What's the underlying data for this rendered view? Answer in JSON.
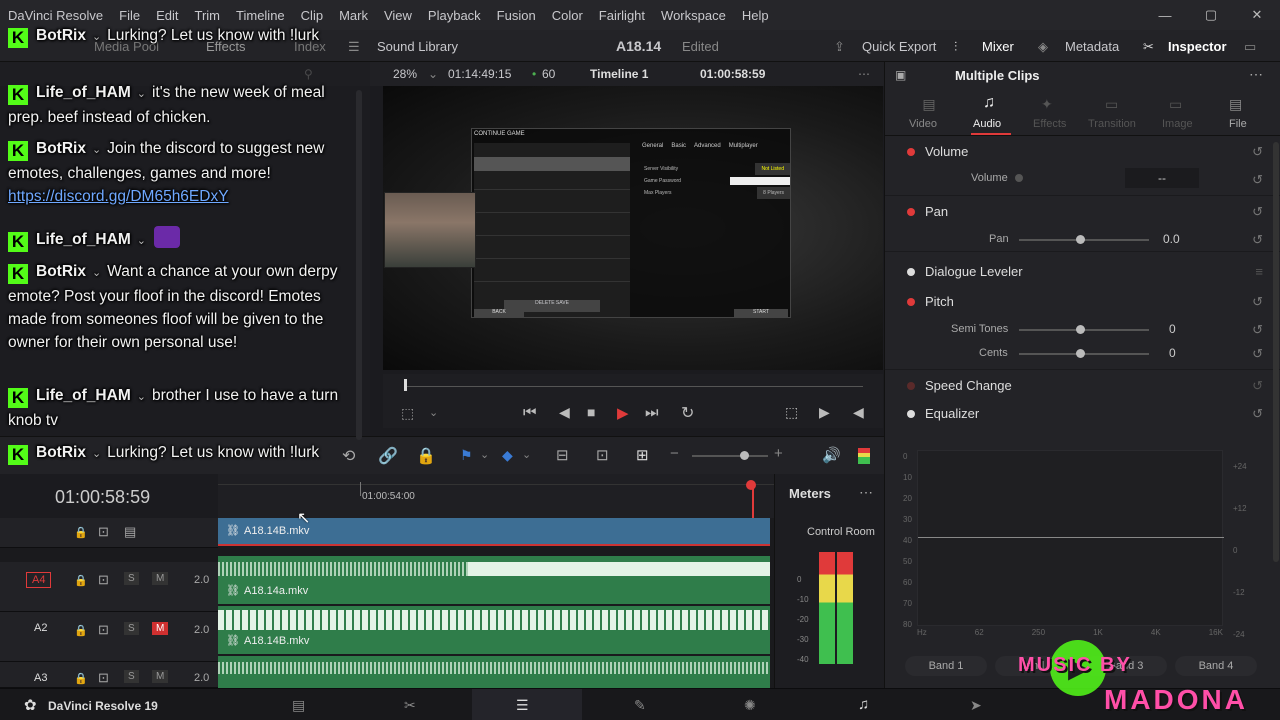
{
  "menu": [
    "DaVinci Resolve",
    "File",
    "Edit",
    "Trim",
    "Timeline",
    "Clip",
    "Mark",
    "View",
    "Playback",
    "Fusion",
    "Color",
    "Fairlight",
    "Workspace",
    "Help"
  ],
  "toolbar": {
    "media_pool": "Media Pool",
    "effects": "Effects",
    "index": "Index",
    "sound_library": "Sound Library",
    "project": "A18.14",
    "status": "Edited",
    "quick_export": "Quick Export",
    "mixer": "Mixer",
    "metadata": "Metadata",
    "inspector": "Inspector"
  },
  "viewer": {
    "zoom": "28%",
    "source_tc": "01:14:49:15",
    "fps": "60",
    "timeline_name": "Timeline 1",
    "timecode": "01:00:58:59"
  },
  "game": {
    "title": "CONTINUE GAME",
    "tabs": [
      "General",
      "Basic",
      "Advanced",
      "Multiplayer"
    ],
    "settings": [
      {
        "label": "Server Visibility",
        "value": "Not Listed"
      },
      {
        "label": "Game Password",
        "value": ""
      },
      {
        "label": "Max Players",
        "value": "8 Players"
      }
    ],
    "back": "BACK",
    "start": "START",
    "delete": "DELETE SAVE"
  },
  "timeline": {
    "timecode": "01:00:58:59",
    "ruler_label": "01:00:54:00",
    "tracks": [
      {
        "name": "",
        "clip": "A18.14B.mkv",
        "type": "video"
      },
      {
        "name": "A4",
        "vol": "2.0",
        "clip": "A18.14a.mkv",
        "s": "S",
        "m": "M"
      },
      {
        "name": "A2",
        "vol": "2.0",
        "clip": "A18.14B.mkv",
        "s": "S",
        "m": "M"
      },
      {
        "name": "A3",
        "vol": "2.0",
        "clip": "",
        "s": "S",
        "m": "M"
      }
    ]
  },
  "meters": {
    "title": "Meters",
    "room": "Control Room",
    "scale": [
      "0",
      "-10",
      "-20",
      "-30",
      "-40"
    ]
  },
  "inspector": {
    "title": "Multiple Clips",
    "tabs": [
      "Video",
      "Audio",
      "Effects",
      "Transition",
      "Image",
      "File"
    ],
    "volume": "Volume",
    "volume_label": "Volume",
    "volume_value": "--",
    "pan": "Pan",
    "pan_label": "Pan",
    "pan_value": "0.0",
    "dialogue": "Dialogue Leveler",
    "pitch": "Pitch",
    "semi": "Semi Tones",
    "semi_value": "0",
    "cents": "Cents",
    "cents_value": "0",
    "speed": "Speed Change",
    "eq": "Equalizer",
    "eq_left": [
      "0",
      "10",
      "20",
      "30",
      "40",
      "50",
      "60",
      "70",
      "80"
    ],
    "eq_right": [
      "+24",
      "+12",
      "0",
      "-12",
      "-24"
    ],
    "eq_freq": [
      "Hz",
      "62",
      "250",
      "1K",
      "4K",
      "16K"
    ],
    "bands": [
      "Band 1",
      "Band 2",
      "Band 3",
      "Band 4"
    ]
  },
  "chat": [
    {
      "user": "BotRix",
      "text": "Lurking? Let us know with !lurk"
    },
    {
      "user": "Life_of_HAM",
      "text": "it's the new week of meal prep. beef instead of chicken."
    },
    {
      "user": "BotRix",
      "text": "Join the discord to suggest new emotes, challenges, games and more!",
      "link": "https://discord.gg/DM65h6EDxY"
    },
    {
      "user": "Life_of_HAM",
      "text": ""
    },
    {
      "user": "BotRix",
      "text": "Want a chance at your own derpy emote? Post your floof in the discord! Emotes made from someones floof will be given to the owner for their own personal use!"
    },
    {
      "user": "Life_of_HAM",
      "text": "brother I use to have a turn knob tv"
    },
    {
      "user": "BotRix",
      "text": "Lurking? Let us know with !lurk"
    }
  ],
  "branding": {
    "app": "DaVinci Resolve 19",
    "watermark_line1": "MUSIC BY",
    "watermark_line2": "MADONA"
  },
  "colors": {
    "accent": "#e03a3a",
    "kick": "#53fc18",
    "clip_audio": "#2f7d4a",
    "clip_video": "#3d6e94"
  }
}
